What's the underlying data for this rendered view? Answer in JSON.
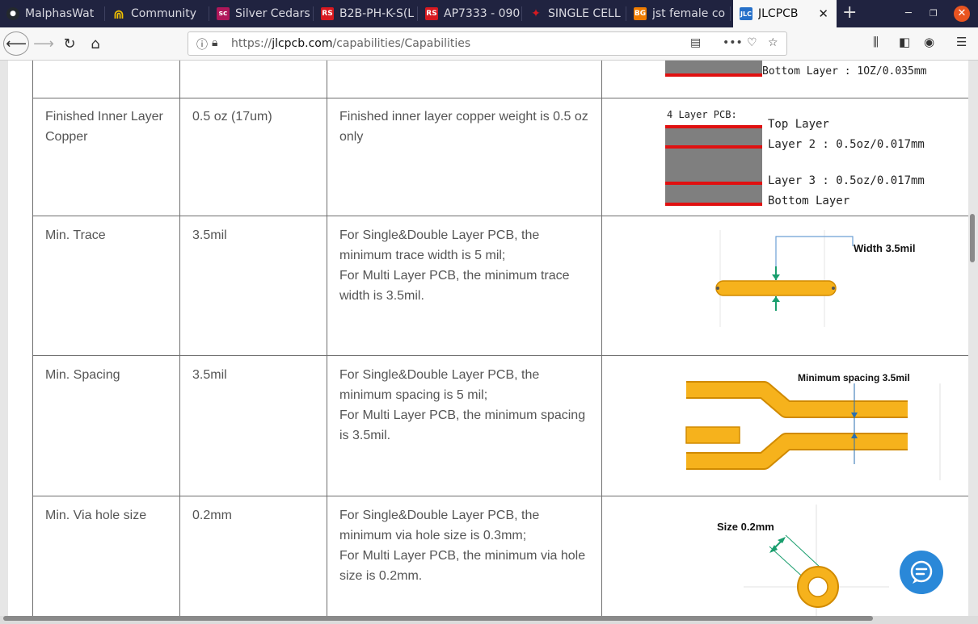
{
  "browser": {
    "tabs": [
      {
        "title": "MalphasWat",
        "icon": "github-icon",
        "color": "#24292e"
      },
      {
        "title": "Community",
        "icon": "arduino-icon",
        "color": "#f0c000"
      },
      {
        "title": "Silver Cedars",
        "icon": "site-icon",
        "color": "#b0175a"
      },
      {
        "title": "B2B-PH-K-S(L",
        "icon": "rs-icon",
        "color": "#d71920"
      },
      {
        "title": "AP7333 - 090",
        "icon": "rs-icon",
        "color": "#d71920"
      },
      {
        "title": "SINGLE CELL",
        "icon": "sparkfun-icon",
        "color": "#d71920"
      },
      {
        "title": "jst female co",
        "icon": "banggood-icon",
        "color": "#f07c00"
      },
      {
        "title": "JLCPCB",
        "icon": "jlc-icon",
        "color": "#2670c9"
      }
    ],
    "new_tab": "+",
    "url_prefix": "https://",
    "url_domain": "jlcpcb.com",
    "url_path": "/capabilities/Capabilities"
  },
  "table": {
    "top_diagram_label": "Bottom Layer : 1OZ/0.035mm",
    "rows": [
      {
        "name": "Finished Inner Layer Copper",
        "value": "0.5 oz (17um)",
        "description": "Finished inner layer copper weight is 0.5 oz only",
        "diagram": {
          "heading": "4 Layer PCB:",
          "top": "Top Layer",
          "l2": "Layer 2 : 0.5oz/0.017mm",
          "l3": "Layer 3 : 0.5oz/0.017mm",
          "bottom": "Bottom Layer"
        }
      },
      {
        "name": "Min. Trace",
        "value": "3.5mil",
        "description_1": "For Single&Double Layer PCB, the minimum trace width is 5 mil;",
        "description_2": "For Multi Layer PCB, the minimum trace width is 3.5mil.",
        "diagram_label": "Width 3.5mil"
      },
      {
        "name": "Min. Spacing",
        "value": "3.5mil",
        "description_1": "For Single&Double Layer PCB, the minimum spacing is 5 mil;",
        "description_2": "For Multi Layer PCB, the minimum spacing is 3.5mil.",
        "diagram_label": "Minimum spacing 3.5mil"
      },
      {
        "name": "Min. Via hole size",
        "value": "0.2mm",
        "description_1": "For Single&Double Layer PCB, the minimum via hole size is 0.3mm;",
        "description_2": "For Multi Layer PCB, the minimum via hole size is 0.2mm.",
        "diagram_label": "Size 0.2mm"
      }
    ]
  },
  "colors": {
    "trace": "#f6b21c",
    "trace_edge": "#d08a00",
    "copper_red": "#e01010",
    "core_gray": "#7f7f7f",
    "accent_green": "#1a9e6e",
    "chat_blue": "#2a88d8"
  }
}
